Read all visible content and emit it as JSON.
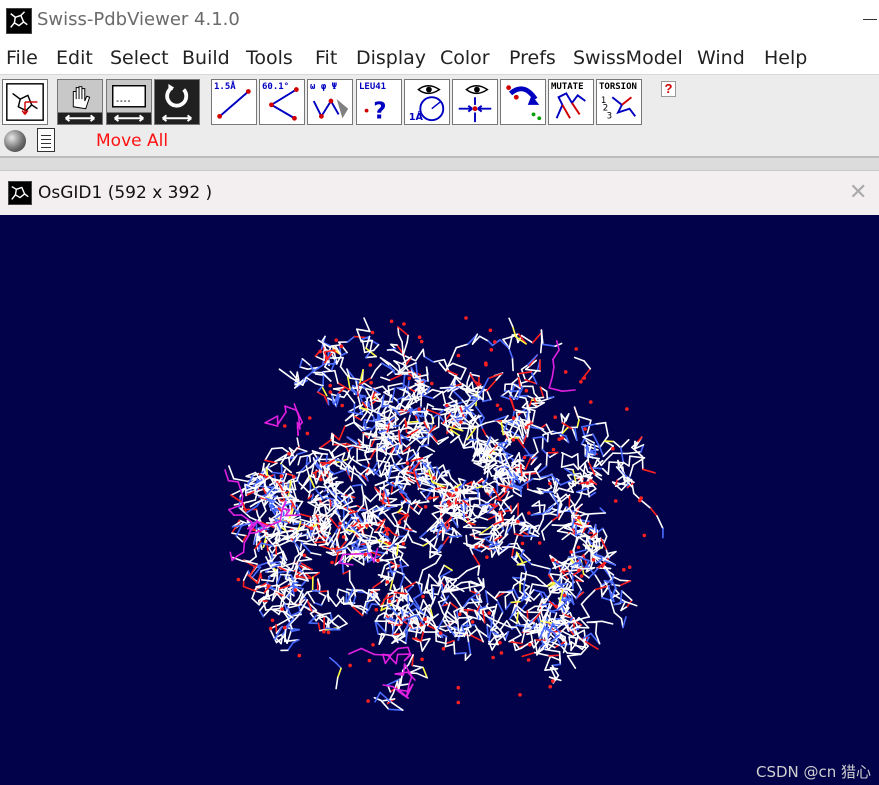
{
  "window": {
    "title": "Swiss-PdbViewer 4.1.0",
    "icon": "molecule-app-icon"
  },
  "menu": [
    "File",
    "Edit",
    "Select",
    "Build",
    "Tools",
    "Fit",
    "Display",
    "Color",
    "Prefs",
    "SwissModel",
    "Wind",
    "Help"
  ],
  "toolbar": {
    "tools": [
      {
        "name": "center-molecule-tool",
        "icon": "center-icon"
      },
      {
        "name": "translate-tool",
        "icon": "hand-icon"
      },
      {
        "name": "zoom-tool",
        "icon": "screen-icon"
      },
      {
        "name": "rotate-tool",
        "icon": "rotate-icon"
      },
      {
        "name": "distance-tool",
        "label": "1.5Å",
        "icon": "distance-icon"
      },
      {
        "name": "angle-tool",
        "label": "60.1°",
        "icon": "angle-icon"
      },
      {
        "name": "dihedral-tool",
        "label": "ω φ Ψ",
        "icon": "dihedral-icon"
      },
      {
        "name": "identify-tool",
        "label": "LEU41",
        "icon": "question-icon"
      },
      {
        "name": "neighbors-tool",
        "label": "1Å",
        "icon": "eye-radius-icon"
      },
      {
        "name": "center-atom-tool",
        "icon": "eye-center-icon"
      },
      {
        "name": "fix-sidechain-tool",
        "icon": "fix-icon"
      },
      {
        "name": "mutate-tool",
        "label": "MUTATE",
        "icon": "mutate-icon"
      },
      {
        "name": "torsion-tool",
        "label": "TORSION",
        "icon": "torsion-icon"
      }
    ],
    "help": "?",
    "move_mode": "Move All"
  },
  "viewer": {
    "title": "OsGID1  (592 x 392 )",
    "background": "#02024a"
  },
  "colors": {
    "carbon": "#ffffff",
    "nitrogen": "#4a6cff",
    "oxygen": "#ff2020",
    "sulfur": "#ffff40",
    "highlight": "#e020e0"
  },
  "watermark": "CSDN @cn 猎心"
}
